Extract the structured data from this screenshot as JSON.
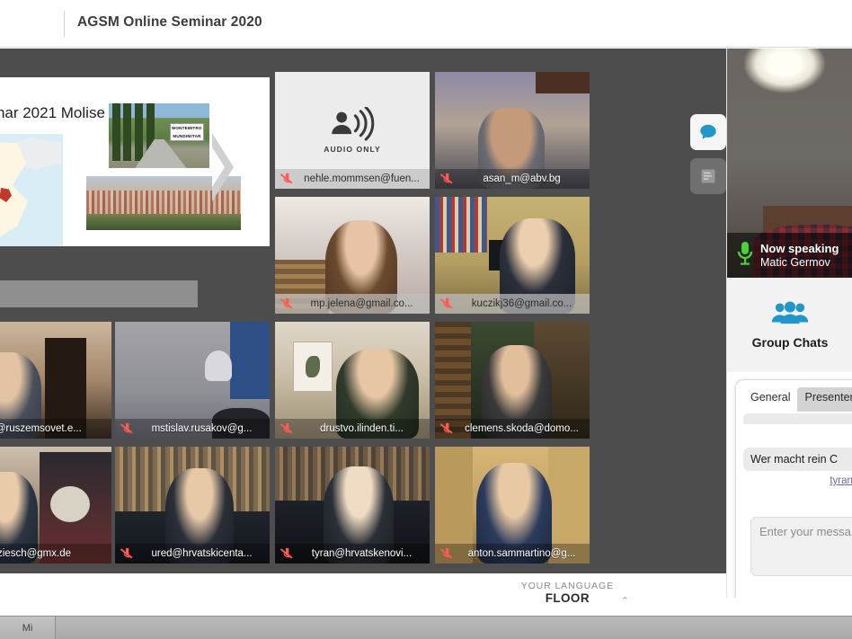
{
  "header": {
    "title": "AGSM Online Seminar 2020"
  },
  "slide": {
    "title": "minar 2021 Molise",
    "sign_line1": "MONTEMITRO",
    "sign_line2": "MUNDIMITAR"
  },
  "float_buttons": [
    {
      "name": "chat-toggle",
      "icon": "chat-bubble-icon",
      "state": "active"
    },
    {
      "name": "notes-toggle",
      "icon": "notes-icon",
      "state": "idle"
    }
  ],
  "tiles": [
    {
      "name": "nehle.mommsen@fuen...",
      "muted": true,
      "audio_only": true,
      "audio_only_label": "AUDIO ONLY",
      "light_bar": true
    },
    {
      "name": "asan_m@abv.bg",
      "muted": true,
      "audio_only": false
    },
    {
      "name": "mp.jelena@gmail.co...",
      "muted": true,
      "audio_only": false,
      "light_bar": true
    },
    {
      "name": "kuczikj36@gmail.co...",
      "muted": true,
      "audio_only": false,
      "light_bar": true
    },
    {
      "name": "fo@ruszemsovet.e...",
      "muted": false,
      "audio_only": false
    },
    {
      "name": "mstislav.rusakov@g...",
      "muted": true,
      "audio_only": false
    },
    {
      "name": "drustvo.ilinden.ti...",
      "muted": true,
      "audio_only": false
    },
    {
      "name": "clemens.skoda@domo...",
      "muted": true,
      "audio_only": false
    },
    {
      "name": "ziesch@gmx.de",
      "muted": false,
      "audio_only": false
    },
    {
      "name": "ured@hrvatskicenta...",
      "muted": true,
      "audio_only": false
    },
    {
      "name": "tyran@hrvatskenovi...",
      "muted": true,
      "audio_only": false
    },
    {
      "name": "anton.sammartino@g...",
      "muted": true,
      "audio_only": false
    }
  ],
  "right_panel": {
    "now_speaking_label": "Now speaking",
    "now_speaking_name": "Matic Germov",
    "group_chats_label": "Group Chats",
    "group_chats_icon": "people-group-icon",
    "mic_icon": "microphone-icon",
    "tabs": [
      {
        "label": "General",
        "selected": true
      },
      {
        "label": "Presenter",
        "selected": false
      }
    ],
    "messages": [
      {
        "text": "",
        "sender": "tyr"
      },
      {
        "text": "Wer macht rein C",
        "sender": "tyran@h"
      }
    ],
    "compose_placeholder": "Enter your messa"
  },
  "language_bar": {
    "caption": "YOUR LANGUAGE",
    "value": "FLOOR",
    "caret": "⌃"
  },
  "taskbar": {
    "start_label": "Mi"
  },
  "colors": {
    "accent_blue": "#2196c9",
    "mic_green": "#4cd137",
    "mute_red": "#ff5a52",
    "stage_bg": "#4d4d4d"
  }
}
